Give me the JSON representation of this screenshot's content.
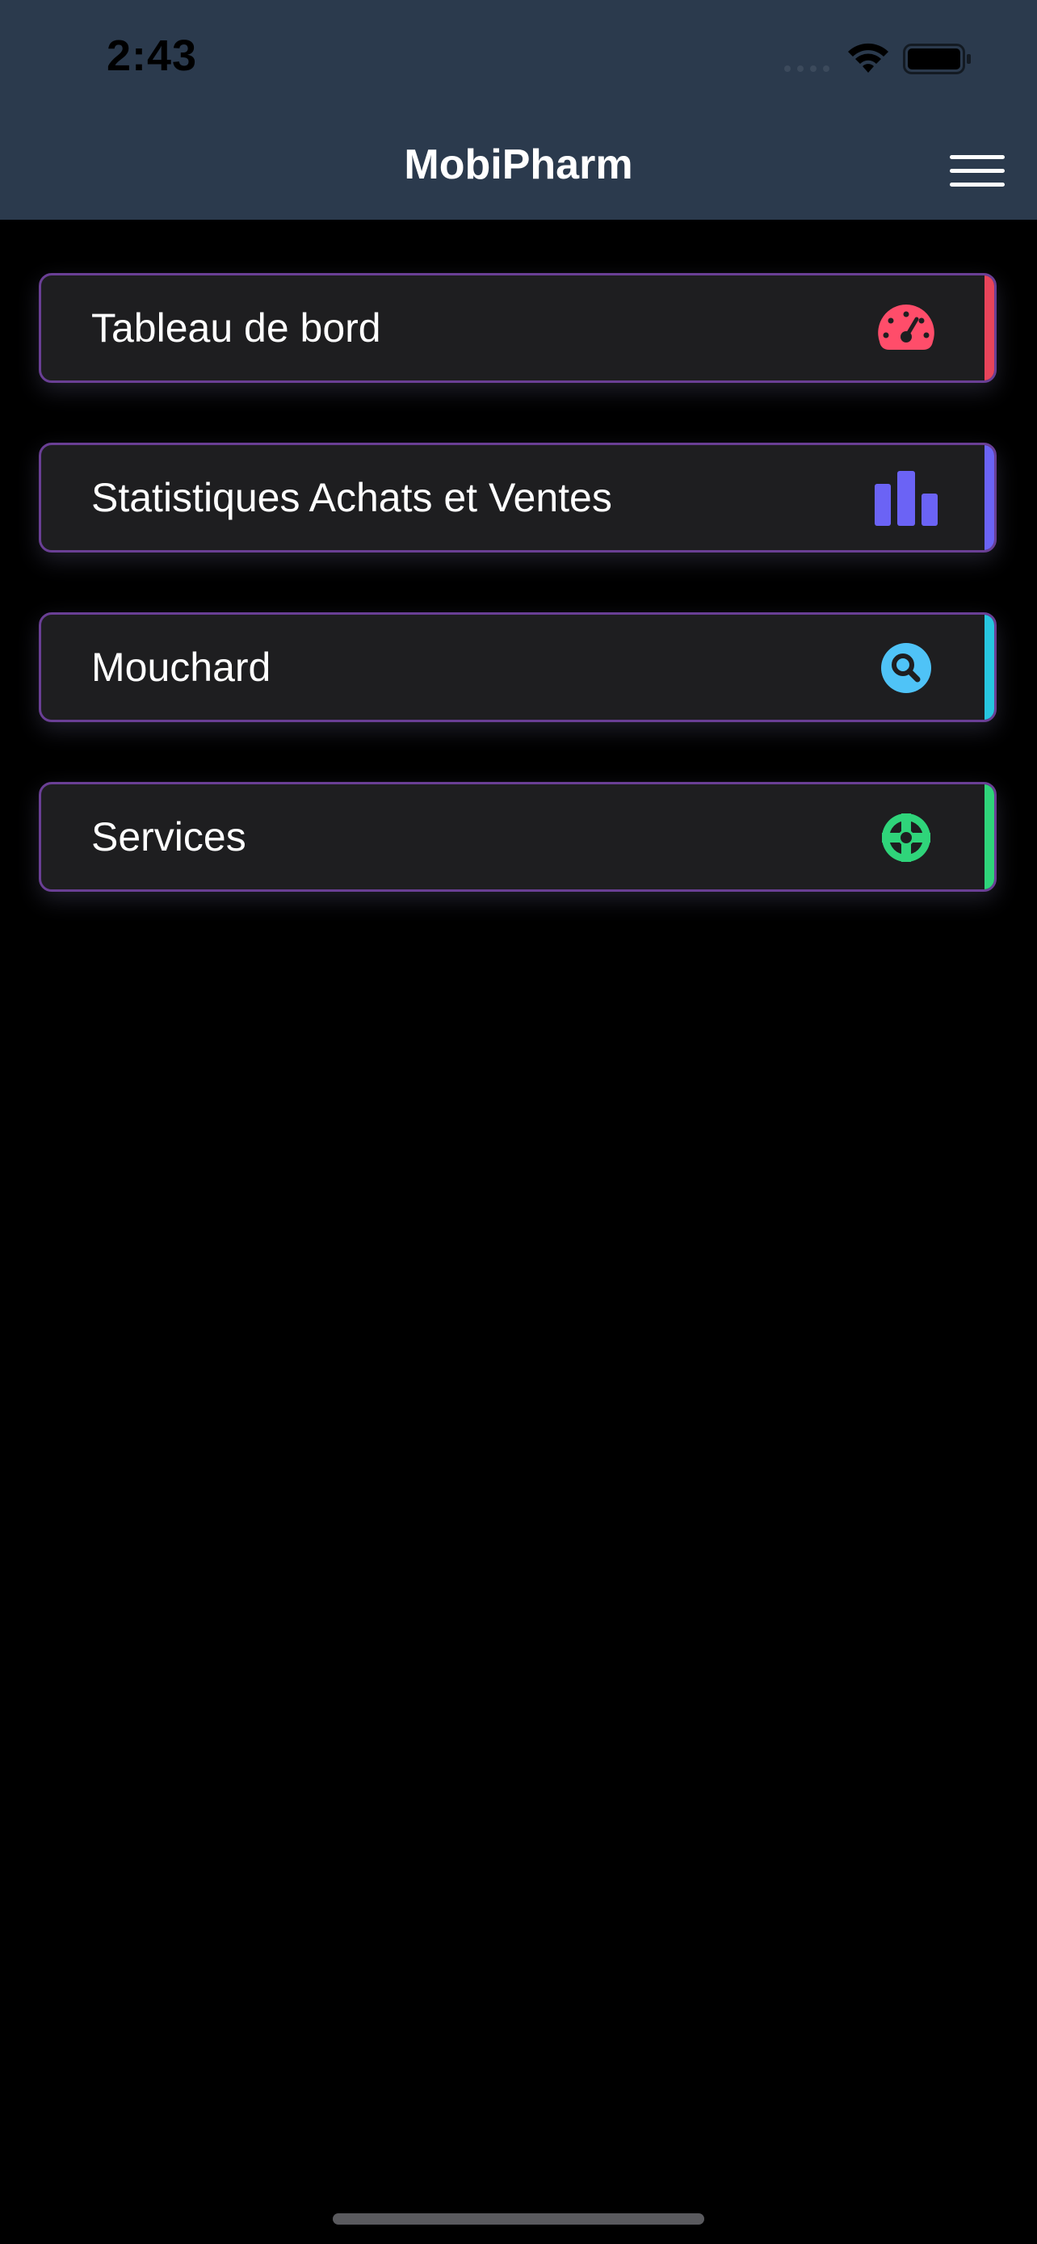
{
  "status_bar": {
    "time": "2:43",
    "icons": [
      "signal-icon",
      "wifi-icon",
      "battery-icon"
    ]
  },
  "nav_bar": {
    "title": "MobiPharm",
    "menu_icon": "hamburger-menu-icon"
  },
  "menu_items": [
    {
      "label": "Tableau de bord",
      "icon": "dashboard-gauge-icon",
      "accent_color": "#e8445a",
      "icon_color": "#ff4d6a"
    },
    {
      "label": "Statistiques Achats et Ventes",
      "icon": "bar-chart-icon",
      "accent_color": "#6b63f5",
      "icon_color": "#6b63f5"
    },
    {
      "label": "Mouchard",
      "icon": "search-icon",
      "accent_color": "#27c6e0",
      "icon_color": "#4fc3f7"
    },
    {
      "label": "Services",
      "icon": "lifebuoy-icon",
      "accent_color": "#2fd47a",
      "icon_color": "#2fd47a"
    }
  ],
  "colors": {
    "header_background": "#2b3a4d",
    "page_background": "#000000",
    "card_background": "#1e1e20",
    "card_border": "#6a3f95"
  }
}
